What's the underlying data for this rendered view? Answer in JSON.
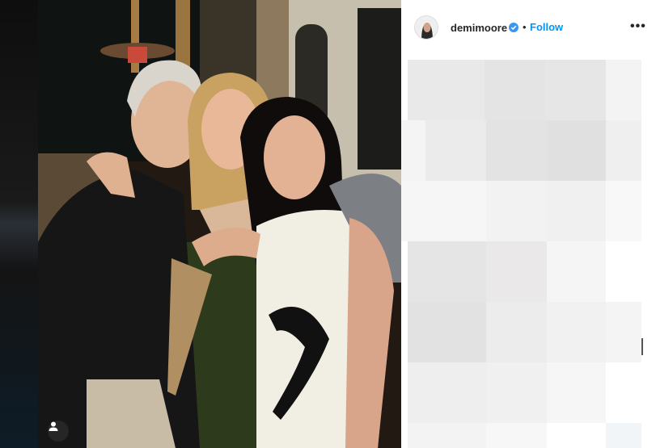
{
  "post": {
    "username": "demimoore",
    "separator": "•",
    "follow_label": "Follow",
    "more_label": "•••"
  },
  "icons": {
    "verified": "verified-badge-icon",
    "tagged_user": "tagged-user-icon",
    "more": "more-options-icon"
  },
  "colors": {
    "follow": "#0095f6",
    "verified": "#3897f0",
    "panel_bg": "#ffffff"
  }
}
